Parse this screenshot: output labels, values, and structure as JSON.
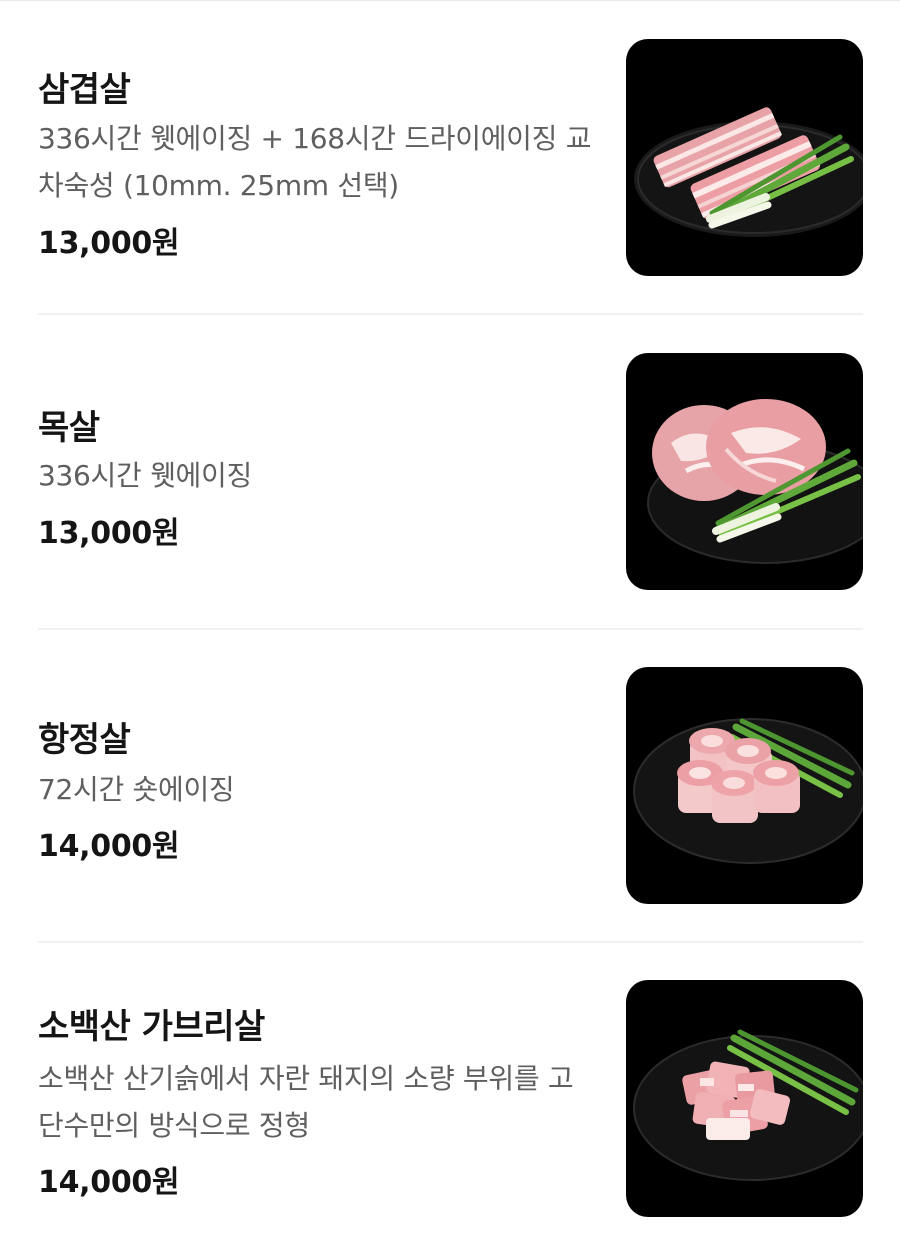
{
  "menu": {
    "items": [
      {
        "name": "삼겹살",
        "description": "336시간 웻에이징 + 168시간 드라이에이징 교차숙성 (10mm. 25mm 선택)",
        "price": "13,000원",
        "image_icon": "pork-belly-photo"
      },
      {
        "name": "목살",
        "description": "336시간 웻에이징",
        "price": "13,000원",
        "image_icon": "pork-neck-photo"
      },
      {
        "name": "항정살",
        "description": "72시간 숏에이징",
        "price": "14,000원",
        "image_icon": "pork-jowl-photo"
      },
      {
        "name": "소백산 가브리살",
        "description": "소백산 산기슭에서 자란 돼지의 소량 부위를 고단수만의 방식으로 정형",
        "price": "14,000원",
        "image_icon": "pork-loin-cap-photo"
      }
    ]
  },
  "colors": {
    "background": "#ffffff",
    "title": "#151515",
    "description": "#5f5f5f",
    "divider": "#f1f1f1",
    "image_background": "#000000"
  }
}
